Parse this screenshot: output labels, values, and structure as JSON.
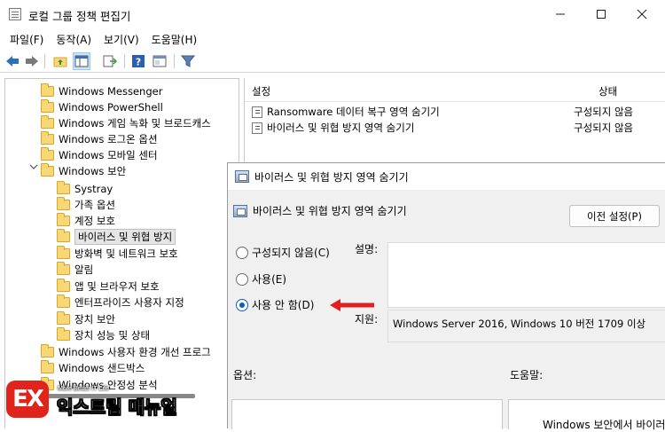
{
  "window": {
    "title": "로컬 그룹 정책 편집기"
  },
  "menu": [
    "파일(F)",
    "동작(A)",
    "보기(V)",
    "도움말(H)"
  ],
  "tree": [
    {
      "label": "Windows Messenger",
      "folder": true
    },
    {
      "label": "Windows PowerShell",
      "folder": true
    },
    {
      "label": "Windows 게임 녹화 및 브로드캐스",
      "folder": true
    },
    {
      "label": "Windows 로그온 옵션",
      "folder": true
    },
    {
      "label": "Windows 모바일 센터",
      "folder": true
    },
    {
      "label": "Windows 보안",
      "folder": true,
      "expanded": true
    },
    {
      "label": "Systray",
      "folder": true
    },
    {
      "label": "가족 옵션",
      "folder": true
    },
    {
      "label": "계정 보호",
      "folder": true
    },
    {
      "label": "바이러스 및 위협 방지",
      "folder": true,
      "selected": true
    },
    {
      "label": "방화벽 및 네트워크 보호",
      "folder": true
    },
    {
      "label": "알림",
      "folder": true
    },
    {
      "label": "앱 및 브라우저 보호",
      "folder": true
    },
    {
      "label": "엔터프라이즈 사용자 지정",
      "folder": true
    },
    {
      "label": "장치 보안",
      "folder": true
    },
    {
      "label": "장치 성능 및 상태",
      "folder": true
    },
    {
      "label": "Windows 사용자 환경 개선 프로그",
      "folder": true
    },
    {
      "label": "Windows 샌드박스",
      "folder": true
    },
    {
      "label": "Windows 안정성 분석",
      "folder": true
    }
  ],
  "settings": {
    "col_setting": "설정",
    "col_state": "상태",
    "rows": [
      {
        "name": "Ransomware 데이터 복구 영역 숨기기",
        "state": "구성되지 않음"
      },
      {
        "name": "바이러스 및 위협 방지 영역 숨기기",
        "state": "구성되지 않음"
      }
    ]
  },
  "dialog": {
    "title": "바이러스 및 위협 방지 영역 숨기기",
    "subtitle": "바이러스 및 위협 방지 영역 숨기기",
    "prev_button": "이전 설정(P)",
    "options": [
      "구성되지 않음(C)",
      "사용(E)",
      "사용 안 함(D)"
    ],
    "selected_option": "사용 안 함(D)",
    "desc_label": "설명:",
    "support_label": "지원:",
    "support_text": "Windows Server 2016, Windows 10 버전 1709 이상",
    "options_label": "옵션:",
    "help_label": "도움말:",
    "help_text": "Windows 보안에서 바이러",
    "arrow_color": "#e02020"
  },
  "watermark": {
    "logo_text": "EX",
    "tagline": "More Better IT Life",
    "name": "익스트림 매뉴얼"
  }
}
